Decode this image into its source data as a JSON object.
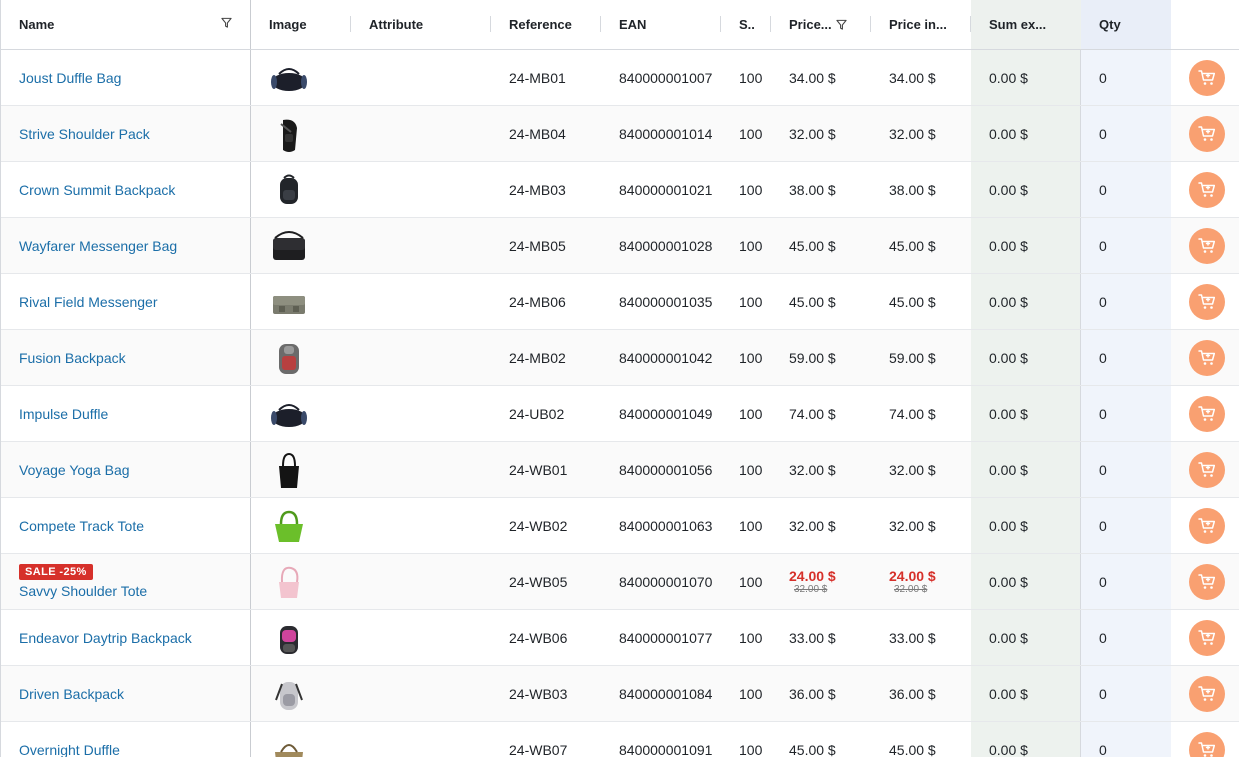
{
  "columns": {
    "name": "Name",
    "image": "Image",
    "attribute": "Attribute",
    "reference": "Reference",
    "ean": "EAN",
    "stock": "S..",
    "price_excl": "Price...",
    "price_incl": "Price in...",
    "sum_excl": "Sum ex...",
    "qty": "Qty"
  },
  "icons": {
    "filter": "filter-icon",
    "cart": "cart-icon"
  },
  "colors": {
    "link": "#1b6ea8",
    "sale": "#d6302a",
    "cart_button": "#f9a071",
    "sum_column_bg": "#edf2ee",
    "qty_column_bg": "#f0f4fb"
  },
  "rows": [
    {
      "name": "Joust Duffle Bag",
      "image": "duffle-black",
      "ref": "24-MB01",
      "ean": "840000001007",
      "stock": "100",
      "price_excl": "34.00 $",
      "price_incl": "34.00 $",
      "sum": "0.00 $",
      "qty": "0"
    },
    {
      "name": "Strive Shoulder Pack",
      "image": "shoulder-black",
      "ref": "24-MB04",
      "ean": "840000001014",
      "stock": "100",
      "price_excl": "32.00 $",
      "price_incl": "32.00 $",
      "sum": "0.00 $",
      "qty": "0"
    },
    {
      "name": "Crown Summit Backpack",
      "image": "backpack-black",
      "ref": "24-MB03",
      "ean": "840000001021",
      "stock": "100",
      "price_excl": "38.00 $",
      "price_incl": "38.00 $",
      "sum": "0.00 $",
      "qty": "0"
    },
    {
      "name": "Wayfarer Messenger Bag",
      "image": "messenger-black",
      "ref": "24-MB05",
      "ean": "840000001028",
      "stock": "100",
      "price_excl": "45.00 $",
      "price_incl": "45.00 $",
      "sum": "0.00 $",
      "qty": "0"
    },
    {
      "name": "Rival Field Messenger",
      "image": "messenger-grey",
      "ref": "24-MB06",
      "ean": "840000001035",
      "stock": "100",
      "price_excl": "45.00 $",
      "price_incl": "45.00 $",
      "sum": "0.00 $",
      "qty": "0"
    },
    {
      "name": "Fusion Backpack",
      "image": "backpack-grey",
      "ref": "24-MB02",
      "ean": "840000001042",
      "stock": "100",
      "price_excl": "59.00 $",
      "price_incl": "59.00 $",
      "sum": "0.00 $",
      "qty": "0"
    },
    {
      "name": "Impulse Duffle",
      "image": "duffle-black",
      "ref": "24-UB02",
      "ean": "840000001049",
      "stock": "100",
      "price_excl": "74.00 $",
      "price_incl": "74.00 $",
      "sum": "0.00 $",
      "qty": "0"
    },
    {
      "name": "Voyage Yoga Bag",
      "image": "tote-black",
      "ref": "24-WB01",
      "ean": "840000001056",
      "stock": "100",
      "price_excl": "32.00 $",
      "price_incl": "32.00 $",
      "sum": "0.00 $",
      "qty": "0"
    },
    {
      "name": "Compete Track Tote",
      "image": "tote-green",
      "ref": "24-WB02",
      "ean": "840000001063",
      "stock": "100",
      "price_excl": "32.00 $",
      "price_incl": "32.00 $",
      "sum": "0.00 $",
      "qty": "0"
    },
    {
      "name": "Savvy Shoulder Tote",
      "image": "tote-pink",
      "ref": "24-WB05",
      "ean": "840000001070",
      "stock": "100",
      "sale_badge": "SALE -25%",
      "price_excl": "24.00 $",
      "price_excl_old": "32.00 $",
      "price_incl": "24.00 $",
      "price_incl_old": "32.00 $",
      "sum": "0.00 $",
      "qty": "0"
    },
    {
      "name": "Endeavor Daytrip Backpack",
      "image": "backpack-pink",
      "ref": "24-WB06",
      "ean": "840000001077",
      "stock": "100",
      "price_excl": "33.00 $",
      "price_incl": "33.00 $",
      "sum": "0.00 $",
      "qty": "0"
    },
    {
      "name": "Driven Backpack",
      "image": "backpack-lightgrey",
      "ref": "24-WB03",
      "ean": "840000001084",
      "stock": "100",
      "price_excl": "36.00 $",
      "price_incl": "36.00 $",
      "sum": "0.00 $",
      "qty": "0"
    },
    {
      "name": "Overnight Duffle",
      "image": "duffle-brown",
      "ref": "24-WB07",
      "ean": "840000001091",
      "stock": "100",
      "price_excl": "45.00 $",
      "price_incl": "45.00 $",
      "sum": "0.00 $",
      "qty": "0"
    }
  ]
}
